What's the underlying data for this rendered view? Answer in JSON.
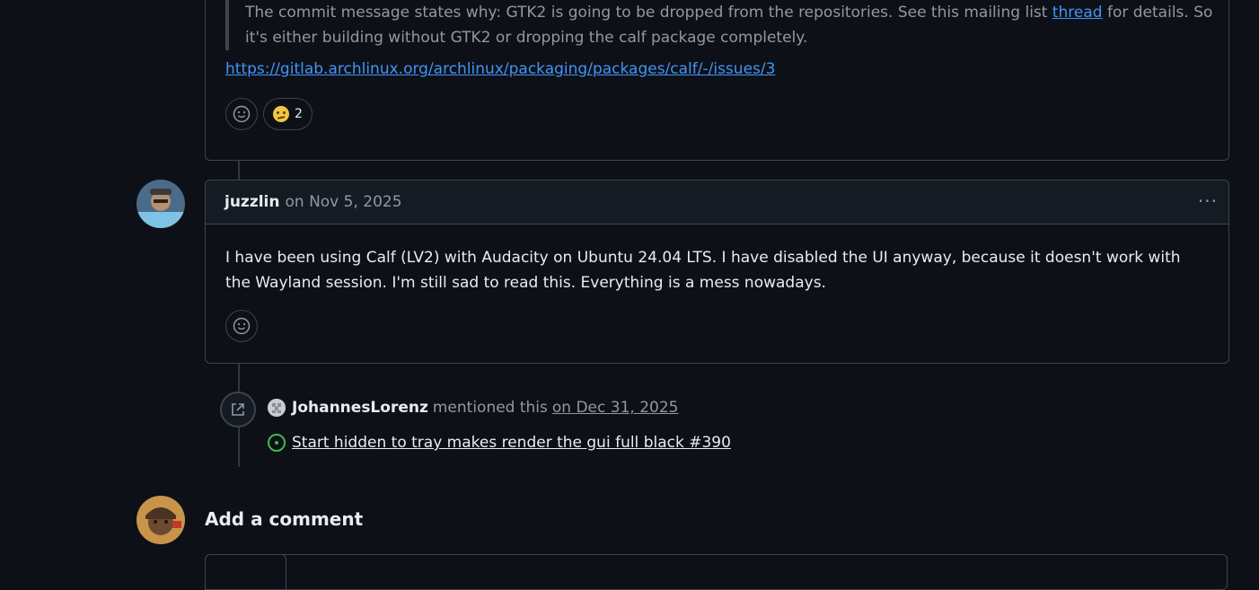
{
  "previous_comment": {
    "quote_text_before_link": "The commit message states why: GTK2 is going to be dropped from the repositories. See this mailing list ",
    "quote_link_text": "thread",
    "quote_text_after_link": " for details. So it's either building without GTK2 or dropping the calf package completely.",
    "issue_link": "https://gitlab.archlinux.org/archlinux/packaging/packages/calf/-/issues/3",
    "reaction_count": "2"
  },
  "comment": {
    "author": "juzzlin",
    "date_text": "on Nov 5, 2025",
    "menu_glyph": "···",
    "body": "I have been using Calf (LV2) with Audacity on Ubuntu 24.04 LTS. I have disabled the UI anyway, because it doesn't work with the Wayland session. I'm still sad to read this. Everything is a mess nowadays."
  },
  "mention_event": {
    "user": "JohannesLorenz",
    "action": "mentioned this",
    "date_text": "on Dec 31, 2025",
    "issue_title": "Start hidden to tray makes render the gui full black #390"
  },
  "add_comment": {
    "title": "Add a comment"
  },
  "colors": {
    "background": "#0d1117",
    "border": "#3d444d",
    "link": "#4493f8",
    "open_issue": "#3fb950"
  }
}
